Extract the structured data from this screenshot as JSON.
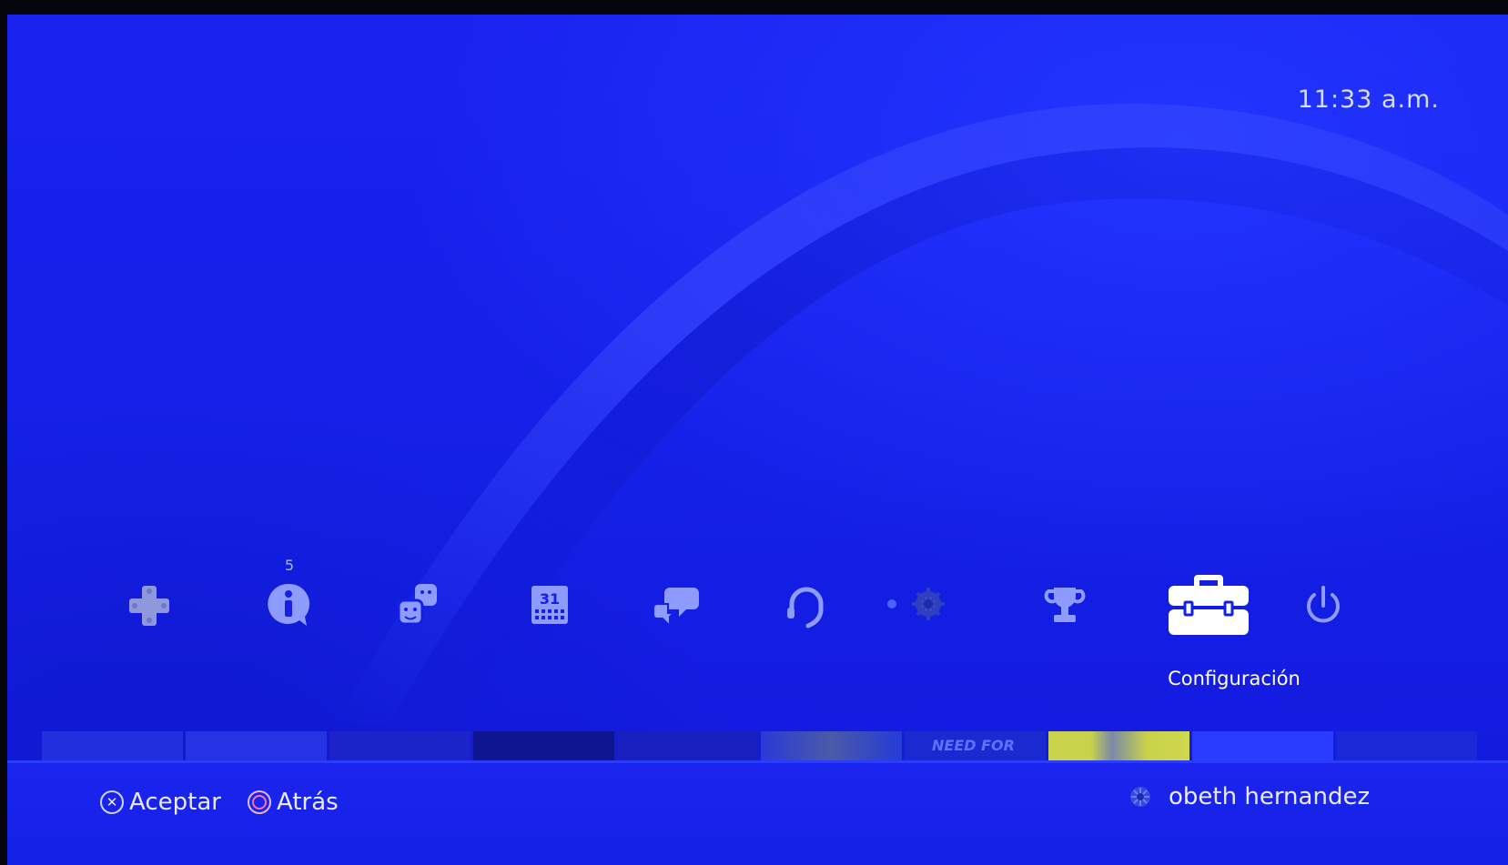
{
  "clock": "11:33 a.m.",
  "function_bar": {
    "items": [
      {
        "name": "whats-new",
        "icon": "dpad-icon"
      },
      {
        "name": "notifications",
        "icon": "info-bubble-icon",
        "badge": "5"
      },
      {
        "name": "friends",
        "icon": "friends-icon"
      },
      {
        "name": "events",
        "icon": "calendar-icon",
        "date": "31"
      },
      {
        "name": "messages",
        "icon": "messages-icon"
      },
      {
        "name": "party",
        "icon": "headset-icon"
      },
      {
        "name": "profile",
        "icon": "avatar-icon"
      },
      {
        "name": "trophies",
        "icon": "trophy-icon"
      },
      {
        "name": "settings",
        "icon": "toolbox-icon"
      },
      {
        "name": "power",
        "icon": "power-icon"
      }
    ],
    "selected_label": "Configuración"
  },
  "footer": {
    "accept_label": "Aceptar",
    "back_label": "Atrás",
    "username": "obeth hernandez"
  },
  "tiles_partial_text": "NEED FOR",
  "colors": {
    "background": "#1520e6",
    "accent_text": "#e8ebff",
    "icon_dim": "#7f8dff"
  }
}
